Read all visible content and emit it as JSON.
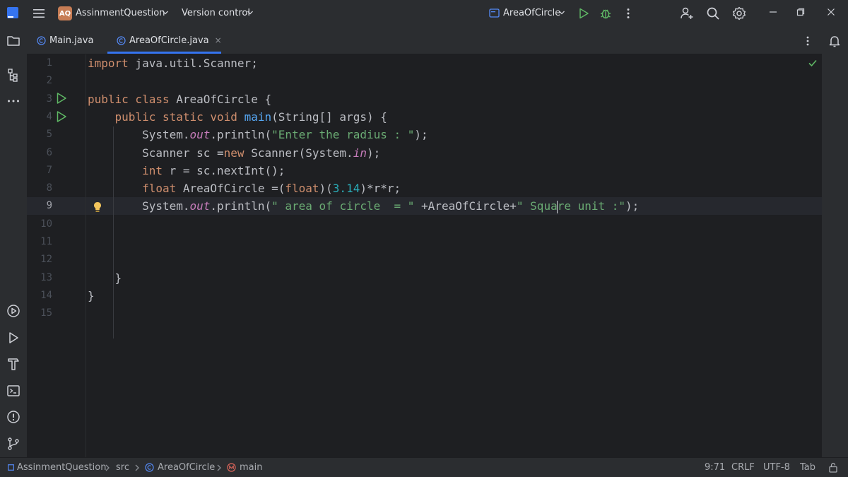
{
  "titlebar": {
    "project_badge": "AQ",
    "project_name": "AssinmentQuestion",
    "vcs_label": "Version control",
    "run_config": "AreaOfCircle"
  },
  "tabs": [
    {
      "label": "Main.java",
      "active": false
    },
    {
      "label": "AreaOfCircle.java",
      "active": true,
      "close": "×"
    }
  ],
  "editor": {
    "line_numbers": [
      "1",
      "2",
      "3",
      "4",
      "5",
      "6",
      "7",
      "8",
      "9",
      "10",
      "11",
      "12",
      "13",
      "14",
      "15"
    ],
    "current_line": 9,
    "lines": [
      [
        {
          "t": "import",
          "c": "kw"
        },
        {
          "t": " java.util.Scanner;",
          "c": ""
        }
      ],
      [],
      [
        {
          "t": "public class",
          "c": "kw"
        },
        {
          "t": " AreaOfCircle {",
          "c": ""
        }
      ],
      [
        {
          "t": "    ",
          "c": ""
        },
        {
          "t": "public static void",
          "c": "kw"
        },
        {
          "t": " ",
          "c": ""
        },
        {
          "t": "main",
          "c": "fn"
        },
        {
          "t": "(String[] args) {",
          "c": ""
        }
      ],
      [
        {
          "t": "        System.",
          "c": ""
        },
        {
          "t": "out",
          "c": "fld"
        },
        {
          "t": ".println(",
          "c": ""
        },
        {
          "t": "\"Enter the radius : \"",
          "c": "str"
        },
        {
          "t": ");",
          "c": ""
        }
      ],
      [
        {
          "t": "        Scanner sc =",
          "c": ""
        },
        {
          "t": "new",
          "c": "kw"
        },
        {
          "t": " Scanner(System.",
          "c": ""
        },
        {
          "t": "in",
          "c": "fld"
        },
        {
          "t": ");",
          "c": ""
        }
      ],
      [
        {
          "t": "        ",
          "c": ""
        },
        {
          "t": "int",
          "c": "kw"
        },
        {
          "t": " r = sc.nextInt();",
          "c": ""
        }
      ],
      [
        {
          "t": "        ",
          "c": ""
        },
        {
          "t": "float",
          "c": "kw"
        },
        {
          "t": " AreaOfCircle =(",
          "c": ""
        },
        {
          "t": "float",
          "c": "kw"
        },
        {
          "t": ")(",
          "c": ""
        },
        {
          "t": "3.14",
          "c": "num"
        },
        {
          "t": ")*r*r;",
          "c": ""
        }
      ],
      [
        {
          "t": "        System.",
          "c": ""
        },
        {
          "t": "out",
          "c": "fld"
        },
        {
          "t": ".println(",
          "c": ""
        },
        {
          "t": "\" area of circle  = \"",
          "c": "str"
        },
        {
          "t": " +AreaOfCircle+",
          "c": ""
        },
        {
          "t": "\" Squa",
          "c": "str"
        },
        {
          "t": "",
          "c": "caret"
        },
        {
          "t": "re unit :\"",
          "c": "str"
        },
        {
          "t": ");",
          "c": ""
        }
      ],
      [],
      [],
      [],
      [
        {
          "t": "    }",
          "c": ""
        }
      ],
      [
        {
          "t": "}",
          "c": ""
        }
      ],
      []
    ]
  },
  "statusbar": {
    "project": "AssinmentQuestion",
    "src": "src",
    "class": "AreaOfCircle",
    "method": "main",
    "position": "9:71",
    "line_sep": "CRLF",
    "encoding": "UTF-8",
    "indent": "Tab"
  },
  "colors": {
    "accent": "#3574f0",
    "run_green": "#5fb865",
    "keyword": "#cf8e6d",
    "string": "#6aab73",
    "number": "#2aacb8",
    "field": "#c77dbb",
    "function": "#56a8f5"
  }
}
